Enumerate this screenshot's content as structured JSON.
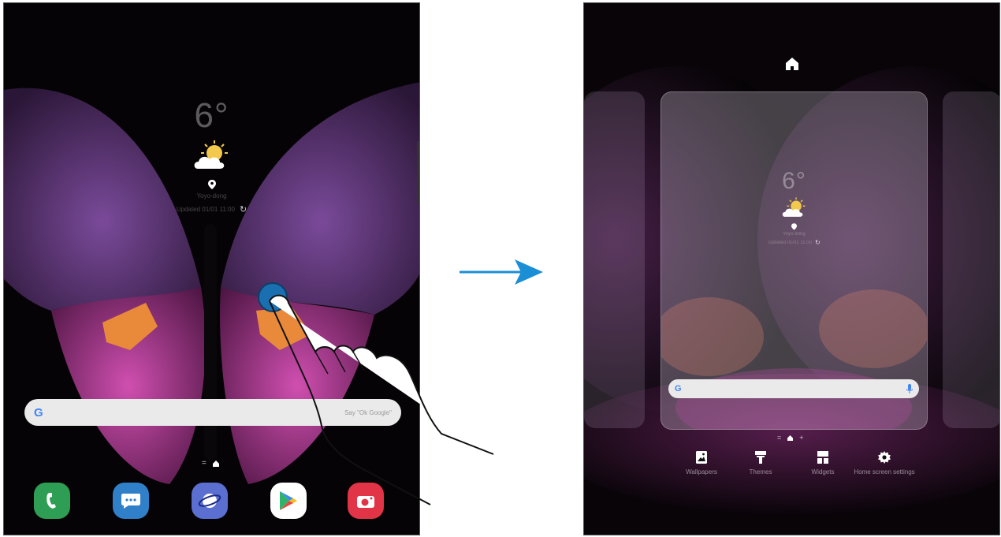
{
  "left_screen": {
    "weather": {
      "temperature": "6°",
      "icon": "partly-cloudy-icon",
      "location": "Yoyo-dong",
      "updated": "Updated 01/01 11:00"
    },
    "search": {
      "logo": "G",
      "voice_hint": "Say \"Ok Google\""
    },
    "dock": [
      {
        "name": "phone-app",
        "icon": "phone-icon",
        "color": "#2e9e55"
      },
      {
        "name": "messages-app",
        "icon": "message-icon",
        "color": "#2f7fc9"
      },
      {
        "name": "internet-app",
        "icon": "planet-icon",
        "color": "#5a6fd0"
      },
      {
        "name": "play-store-app",
        "icon": "play-store-icon",
        "color": "#ffffff"
      },
      {
        "name": "camera-app",
        "icon": "camera-icon",
        "color": "#e23447"
      }
    ]
  },
  "right_screen": {
    "weather": {
      "temperature": "6°",
      "location": "Yoyo-dong",
      "updated": "Updated 01/01 11:00"
    },
    "search": {
      "logo": "G"
    },
    "options": [
      {
        "name": "wallpapers-option",
        "icon": "image-icon",
        "label": "Wallpapers"
      },
      {
        "name": "themes-option",
        "icon": "brush-icon",
        "label": "Themes"
      },
      {
        "name": "widgets-option",
        "icon": "widgets-icon",
        "label": "Widgets"
      },
      {
        "name": "home-screen-settings-option",
        "icon": "gear-icon",
        "label": "Home screen settings"
      }
    ]
  },
  "colors": {
    "accent": "#1a8fd6",
    "touch": "#1a6fb0"
  }
}
